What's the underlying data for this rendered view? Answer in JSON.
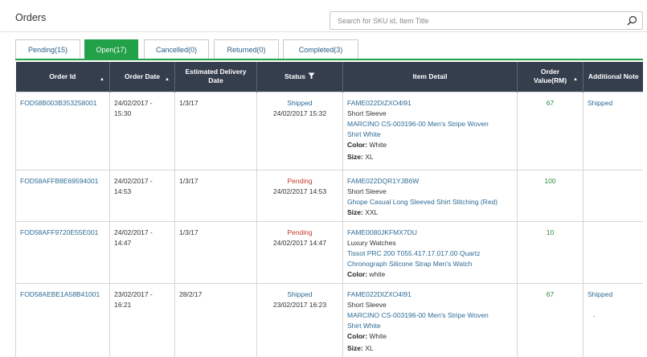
{
  "page": {
    "title": "Orders"
  },
  "search": {
    "placeholder": "Search for SKU id, Item Title",
    "value": ""
  },
  "tabs": [
    {
      "label": "Pending(15)",
      "active": false
    },
    {
      "label": "Open(17)",
      "active": true
    },
    {
      "label": "Cancelled(0)",
      "active": false
    },
    {
      "label": "Returned(0)",
      "active": false
    },
    {
      "label": "Completed(3)",
      "active": false
    }
  ],
  "table": {
    "headers": {
      "order_id": "Order Id",
      "order_date": "Order Date",
      "estimated_delivery_line1": "Estimated Delivery",
      "estimated_delivery_line2": "Date",
      "status": "Status",
      "item_detail": "Item Detail",
      "order_value_line1": "Order",
      "order_value_line2": "Value(RM)",
      "additional_note": "Additional Note"
    },
    "rows": [
      {
        "order_id": "FOD58B003B353258001",
        "order_date": "24/02/2017 - 15:30",
        "estimated_delivery": "1/3/17",
        "status": "Shipped",
        "status_time": "24/02/2017 15:32",
        "sku": "FAME022DIZXO4I91",
        "category": "Short Sleeve",
        "title_line1": "MARCINO CS-003196-00 Men's Stripe Woven",
        "title_line2": "Shirt White",
        "color_label": "Color:",
        "color": "White",
        "size_label": "Size:",
        "size": "XL",
        "value": "67",
        "note": "Shipped"
      },
      {
        "order_id": "FOD58AFFB8E69594001",
        "order_date": "24/02/2017 - 14:53",
        "estimated_delivery": "1/3/17",
        "status": "Pending",
        "status_time": "24/02/2017 14:53",
        "sku": "FAME022DQR1YJB6W",
        "category": "Short Sleeve",
        "title_line1": "Ghope Casual Long Sleeved Shirt Stitching (Red)",
        "title_line2": "",
        "color_label": "",
        "color": "",
        "size_label": "Size:",
        "size": "XXL",
        "value": "100",
        "note": ""
      },
      {
        "order_id": "FOD58AFF9720E55E001",
        "order_date": "24/02/2017 - 14:47",
        "estimated_delivery": "1/3/17",
        "status": "Pending",
        "status_time": "24/02/2017 14:47",
        "sku": "FAME0080JKFMX7DU",
        "category": "Luxury Watches",
        "title_line1": "Tissot PRC 200 T055.417.17.017.00 Quartz",
        "title_line2": "Chronograph Silicone Strap Men's Watch",
        "color_label": "Color:",
        "color": "white",
        "size_label": "",
        "size": "",
        "value": "10",
        "note": ""
      },
      {
        "order_id": "FOD58AEBE1A58B41001",
        "order_date": "23/02/2017 - 16:21",
        "estimated_delivery": "28/2/17",
        "status": "Shipped",
        "status_time": "23/02/2017 16:23",
        "sku": "FAME022DIZXO4I91",
        "category": "Short Sleeve",
        "title_line1": "MARCINO CS-003196-00 Men's Stripe Woven",
        "title_line2": "Shirt White",
        "color_label": "Color:",
        "color": "White",
        "size_label": "Size:",
        "size": "XL",
        "value": "67",
        "note": "Shipped",
        "note_extra": "."
      }
    ]
  },
  "colors": {
    "accent_green": "#23a148",
    "header_bg": "#353e4d",
    "link_blue": "#2d6b96",
    "pending_red": "#c0392b",
    "value_green": "#2a8a3c"
  },
  "icons": {
    "search": "search-icon",
    "filter": "filter-icon",
    "sort": "sort-caret-icon"
  }
}
